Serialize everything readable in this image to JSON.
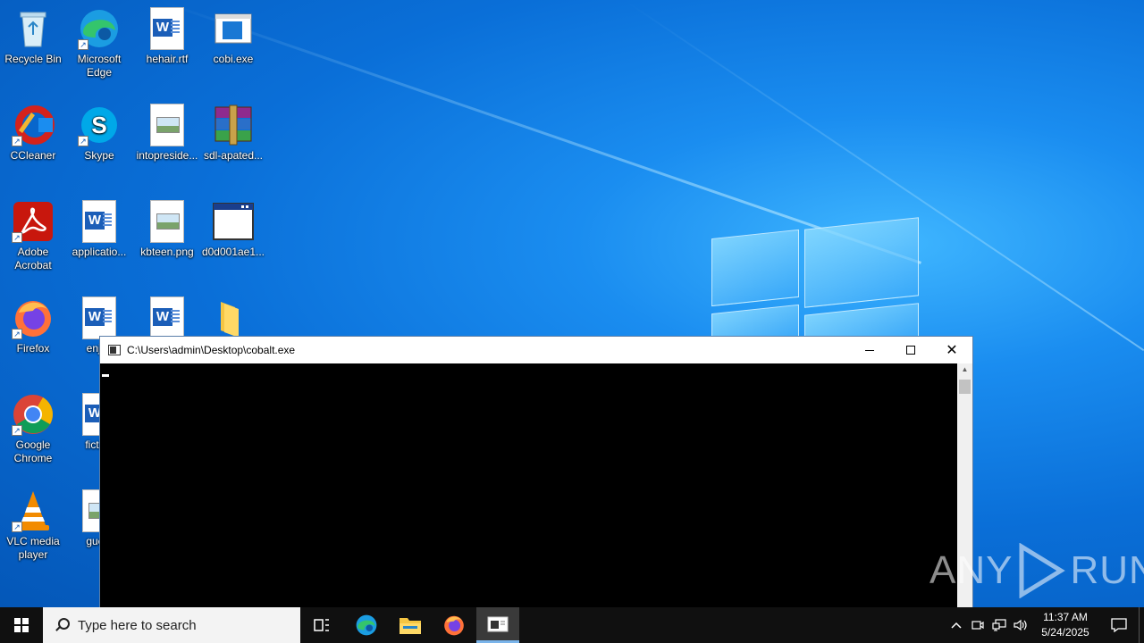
{
  "desktop": {
    "icons": [
      {
        "label": "Recycle Bin",
        "icon": "recycle-bin-icon"
      },
      {
        "label": "Microsoft Edge",
        "icon": "edge-icon"
      },
      {
        "label": "hehair.rtf",
        "icon": "word-document-icon"
      },
      {
        "label": "cobi.exe",
        "icon": "executable-icon"
      },
      {
        "label": "CCleaner",
        "icon": "ccleaner-icon"
      },
      {
        "label": "Skype",
        "icon": "skype-icon"
      },
      {
        "label": "intopreside...",
        "icon": "image-file-icon"
      },
      {
        "label": "sdl-apated...",
        "icon": "winrar-archive-icon"
      },
      {
        "label": "Adobe Acrobat",
        "icon": "acrobat-icon"
      },
      {
        "label": "applicatio...",
        "icon": "word-document-icon"
      },
      {
        "label": "kbteen.png",
        "icon": "image-file-icon"
      },
      {
        "label": "d0d001ae1...",
        "icon": "window-app-icon"
      },
      {
        "label": "Firefox",
        "icon": "firefox-icon"
      },
      {
        "label": "enjoy",
        "icon": "word-document-icon"
      },
      {
        "label": "",
        "icon": "word-document-icon"
      },
      {
        "label": "",
        "icon": "folder-icon"
      },
      {
        "label": "Google Chrome",
        "icon": "chrome-icon"
      },
      {
        "label": "fiction",
        "icon": "word-document-icon"
      },
      {
        "label": "VLC media player",
        "icon": "vlc-icon"
      },
      {
        "label": "guest",
        "icon": "image-file-icon"
      }
    ]
  },
  "console": {
    "title": "C:\\Users\\admin\\Desktop\\cobalt.exe",
    "background": "#000000"
  },
  "watermark": {
    "left_text": "ANY",
    "right_text": "RUN"
  },
  "taskbar": {
    "search_placeholder": "Type here to search",
    "apps": [
      "task-view-icon",
      "edge-icon",
      "file-explorer-icon",
      "firefox-icon",
      "console-app-icon"
    ],
    "clock_time": "11:37 AM",
    "clock_date": "5/24/2025"
  },
  "colors": {
    "accent": "#0a6fd8",
    "taskbar": "#101010",
    "active_indicator": "#7ab4ea"
  }
}
